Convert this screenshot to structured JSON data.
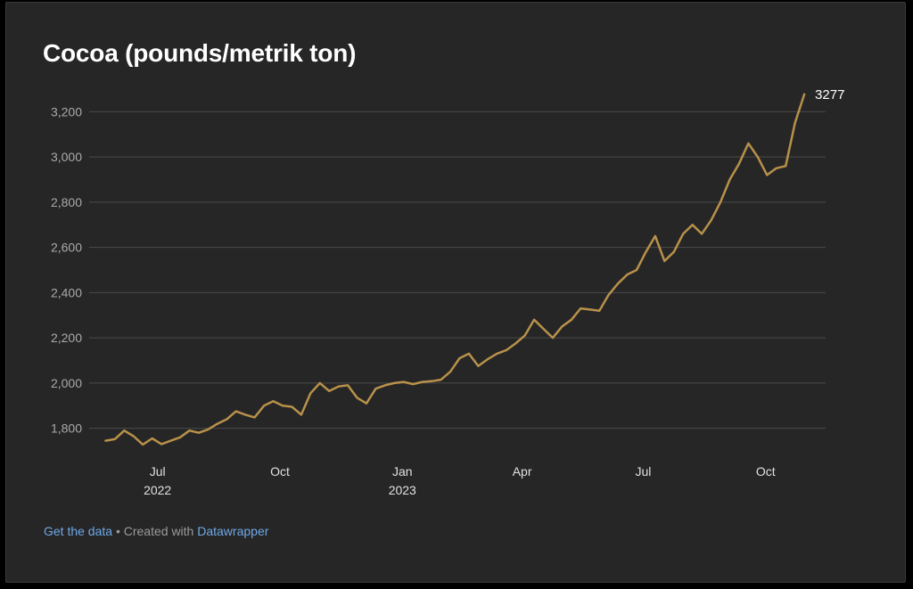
{
  "chart_data": {
    "type": "line",
    "title": "Cocoa (pounds/metrik ton)",
    "xlabel": "",
    "ylabel": "",
    "ylim": [
      1700,
      3300
    ],
    "xlim": [
      "2022-05-16",
      "2023-11-07"
    ],
    "y_ticks": [
      1800,
      2000,
      2200,
      2400,
      2600,
      2800,
      3000,
      3200
    ],
    "y_tick_labels": [
      "1,800",
      "2,000",
      "2,200",
      "2,400",
      "2,600",
      "2,800",
      "3,000",
      "3,200"
    ],
    "x_ticks": [
      {
        "date": "2022-07-01",
        "label": "Jul",
        "sublabel": "2022"
      },
      {
        "date": "2022-10-01",
        "label": "Oct",
        "sublabel": ""
      },
      {
        "date": "2023-01-01",
        "label": "Jan",
        "sublabel": "2023"
      },
      {
        "date": "2023-04-01",
        "label": "Apr",
        "sublabel": ""
      },
      {
        "date": "2023-07-01",
        "label": "Jul",
        "sublabel": ""
      },
      {
        "date": "2023-10-01",
        "label": "Oct",
        "sublabel": ""
      }
    ],
    "grid": true,
    "legend": "none",
    "line_color": "#b8914a",
    "end_label": "3277",
    "series": [
      {
        "x": [
          "2022-05-23",
          "2022-05-30",
          "2022-06-06",
          "2022-06-13",
          "2022-06-20",
          "2022-06-27",
          "2022-07-04",
          "2022-07-11",
          "2022-07-18",
          "2022-07-25",
          "2022-08-01",
          "2022-08-08",
          "2022-08-15",
          "2022-08-22",
          "2022-08-29",
          "2022-09-05",
          "2022-09-12",
          "2022-09-19",
          "2022-09-26",
          "2022-10-03",
          "2022-10-10",
          "2022-10-17",
          "2022-10-24",
          "2022-10-31",
          "2022-11-07",
          "2022-11-14",
          "2022-11-21",
          "2022-11-28",
          "2022-12-05",
          "2022-12-12",
          "2022-12-19",
          "2022-12-26",
          "2023-01-02",
          "2023-01-09",
          "2023-01-16",
          "2023-01-23",
          "2023-01-30",
          "2023-02-06",
          "2023-02-13",
          "2023-02-20",
          "2023-02-27",
          "2023-03-06",
          "2023-03-13",
          "2023-03-20",
          "2023-03-27",
          "2023-04-03",
          "2023-04-10",
          "2023-04-17",
          "2023-04-24",
          "2023-05-01",
          "2023-05-08",
          "2023-05-15",
          "2023-05-22",
          "2023-05-29",
          "2023-06-05",
          "2023-06-12",
          "2023-06-19",
          "2023-06-26",
          "2023-07-03",
          "2023-07-10",
          "2023-07-17",
          "2023-07-24",
          "2023-07-31",
          "2023-08-07",
          "2023-08-14",
          "2023-08-21",
          "2023-08-28",
          "2023-09-04",
          "2023-09-11",
          "2023-09-18",
          "2023-09-25",
          "2023-10-02",
          "2023-10-09",
          "2023-10-16",
          "2023-10-23",
          "2023-10-30"
        ],
        "y": [
          1745,
          1752,
          1790,
          1765,
          1728,
          1755,
          1730,
          1745,
          1760,
          1790,
          1780,
          1795,
          1820,
          1840,
          1875,
          1860,
          1848,
          1900,
          1920,
          1900,
          1895,
          1860,
          1955,
          2000,
          1965,
          1985,
          1990,
          1935,
          1910,
          1975,
          1990,
          2000,
          2005,
          1995,
          2005,
          2008,
          2015,
          2050,
          2110,
          2130,
          2075,
          2105,
          2130,
          2145,
          2175,
          2210,
          2280,
          2240,
          2200,
          2250,
          2280,
          2330,
          2325,
          2320,
          2390,
          2440,
          2480,
          2500,
          2580,
          2650,
          2540,
          2580,
          2660,
          2700,
          2660,
          2720,
          2800,
          2900,
          2970,
          3060,
          3000,
          2920,
          2950,
          2960,
          3150,
          3277
        ]
      }
    ]
  },
  "footer": {
    "get_data": "Get the data",
    "separator": " • Created with ",
    "tool": "Datawrapper"
  }
}
